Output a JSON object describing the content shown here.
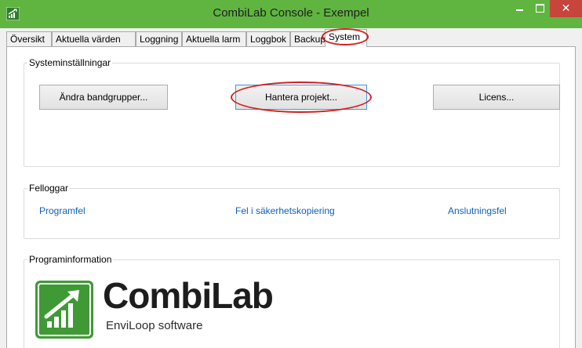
{
  "window": {
    "title": "CombiLab Console - Exempel",
    "close_glyph": "✕"
  },
  "tabs": [
    {
      "label": "Översikt"
    },
    {
      "label": "Aktuella värden"
    },
    {
      "label": "Loggning"
    },
    {
      "label": "Aktuella larm"
    },
    {
      "label": "Loggbok"
    },
    {
      "label": "Backup"
    },
    {
      "label": "System",
      "active": true
    }
  ],
  "system_settings": {
    "title": "Systeminställningar",
    "buttons": {
      "edit_bandgroups": "Ändra bandgrupper...",
      "manage_project": "Hantera projekt...",
      "license": "Licens..."
    }
  },
  "error_logs": {
    "title": "Felloggar",
    "links": {
      "program_error": "Programfel",
      "backup_error": "Fel i säkerhetskopiering",
      "connection_error": "Anslutningsfel"
    }
  },
  "program_info": {
    "title": "Programinformation",
    "logo_name": "CombiLab",
    "logo_subtitle": "EnviLoop software"
  },
  "colors": {
    "titlebar": "#5fb53f",
    "close_button": "#c7453a",
    "highlight_oval": "#d41f1f",
    "link": "#1060b8",
    "logo_green": "#3f9a35"
  },
  "icons": {
    "app": "combilab-chart-icon",
    "minimize": "minimize-icon",
    "maximize": "maximize-icon",
    "close": "close-icon"
  }
}
